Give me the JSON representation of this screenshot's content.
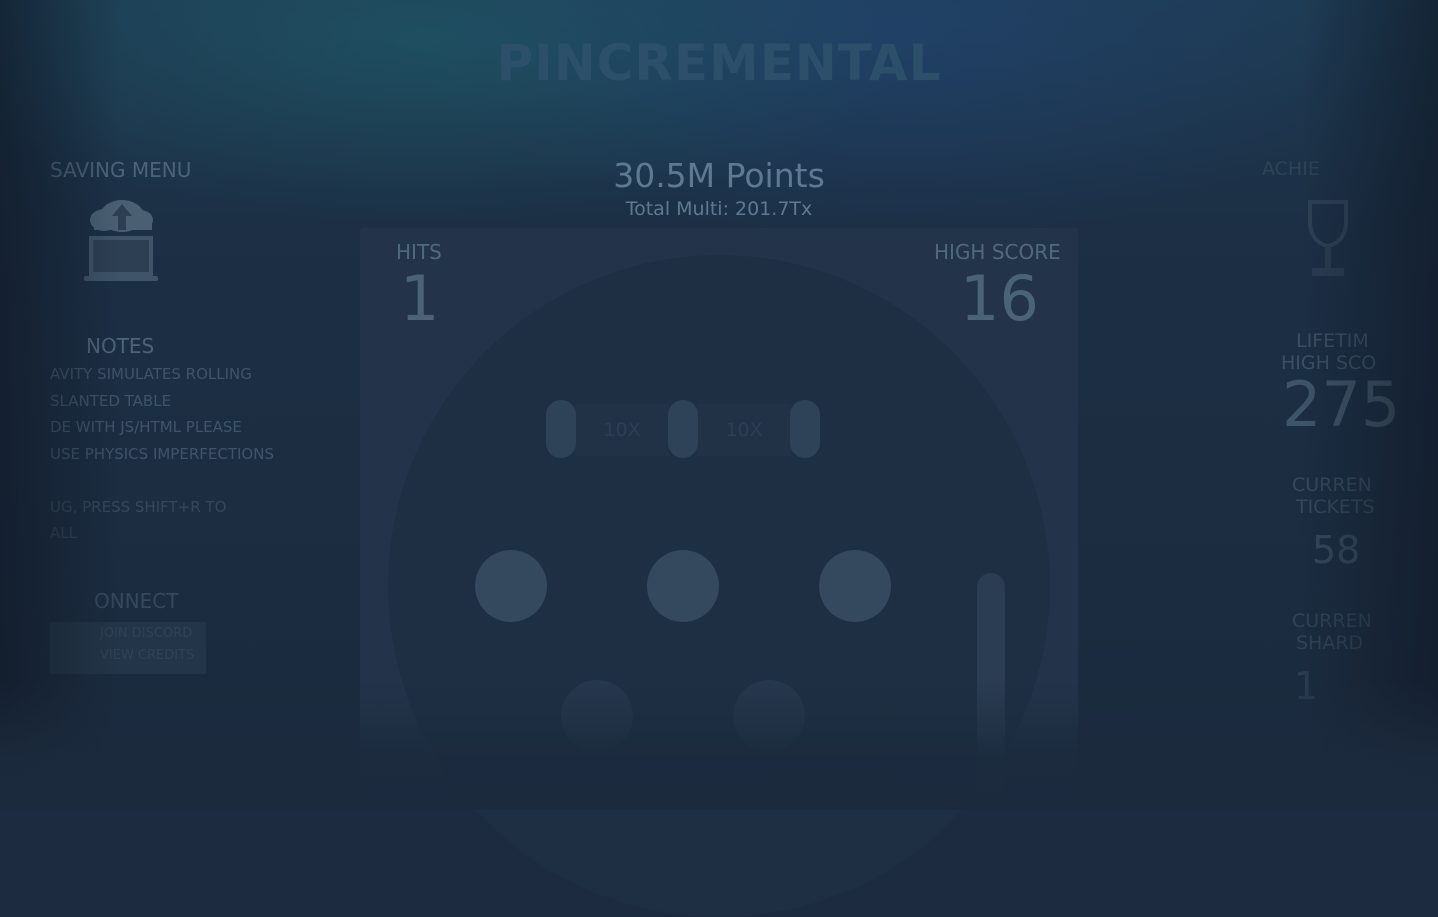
{
  "game": {
    "title": "PINCREMENTAL",
    "points": "30.5M Points",
    "total_multi": "Total Multi: 201.7Tx"
  },
  "left_panel": {
    "saving_menu_label": "SAVING MENU",
    "notes_heading": "NOTES",
    "notes_lines": [
      "AVITY SIMULATES ROLLING",
      "SLANTED TABLE",
      "DE WITH JS/HTML PLEASE",
      "USE PHYSICS IMPERFECTIONS",
      "",
      "UG, PRESS SHIFT+R TO",
      "ALL"
    ],
    "connect_heading": "ONNECT",
    "connect_lines": [
      "JOIN DISCORD",
      "VIEW CREDITS"
    ]
  },
  "board": {
    "hits_label": "HITS",
    "hits_value": "1",
    "high_score_label": "HIGH SCORE",
    "high_score_value": "16",
    "lanes": [
      "10X",
      "10X"
    ]
  },
  "right_panel": {
    "achievements_label": "ACHIE",
    "lifetime_label_1": "LIFETIM",
    "lifetime_label_2": "HIGH SCO",
    "lifetime_value": "275",
    "tickets_label_1": "CURREN",
    "tickets_label_2": "TICKETS",
    "tickets_value": "58",
    "shards_label_1": "CURREN",
    "shards_label_2": "SHARD",
    "shards_value": "1"
  },
  "colors": {
    "background": "#1c2b3f",
    "title": "#2c4f6a",
    "board": "#23344a",
    "bumper": "#34485e"
  },
  "icons": [
    "cloud-upload-laptop-icon",
    "trophy-icon"
  ]
}
